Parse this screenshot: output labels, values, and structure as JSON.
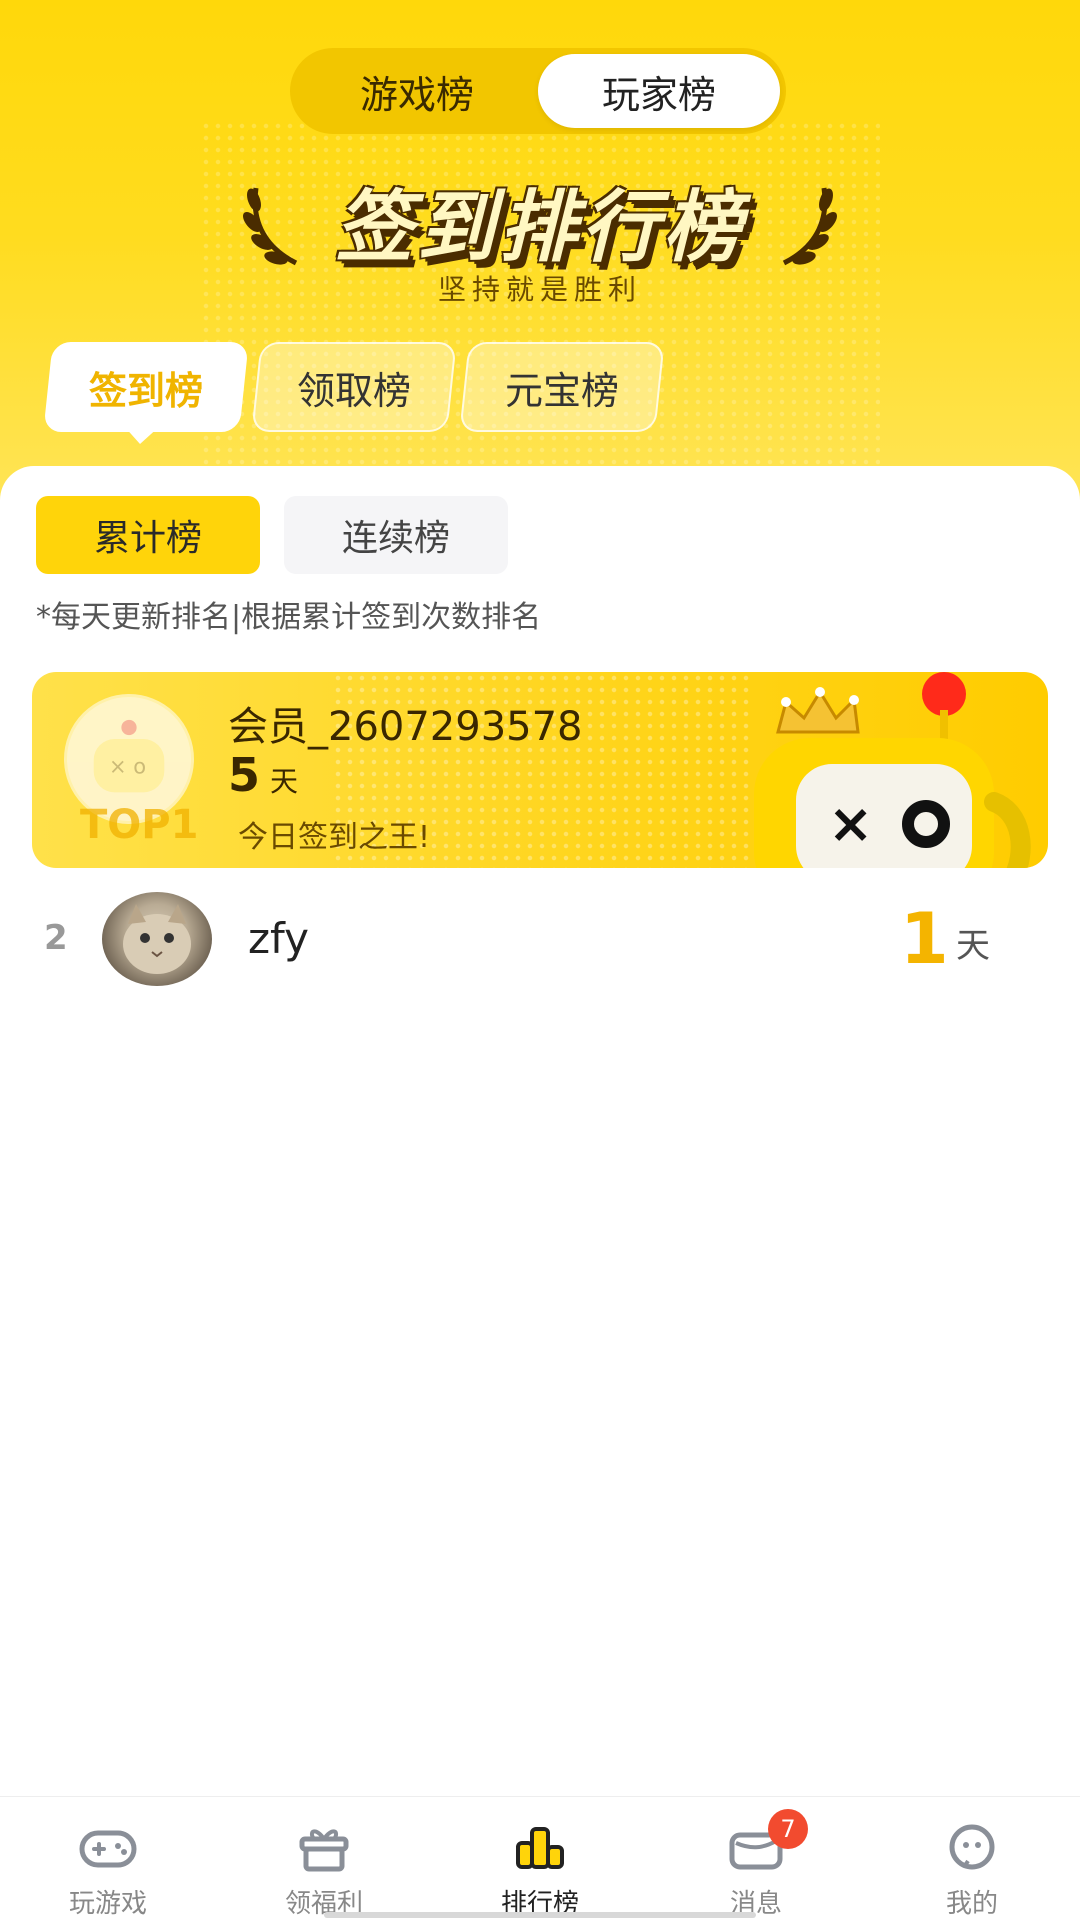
{
  "top_toggle": {
    "game_rank": "游戏榜",
    "player_rank": "玩家榜",
    "active": "player_rank"
  },
  "banner": {
    "title": "签到排行榜",
    "subtitle": "坚持就是胜利"
  },
  "tabs": [
    {
      "label": "签到榜",
      "active": true
    },
    {
      "label": "领取榜",
      "active": false
    },
    {
      "label": "元宝榜",
      "active": false
    }
  ],
  "subtabs": [
    {
      "label": "累计榜",
      "active": true
    },
    {
      "label": "连续榜",
      "active": false
    }
  ],
  "note": "*每天更新排名|根据累计签到次数排名",
  "top1": {
    "rank_label": "TOP1",
    "name": "会员_2607293578",
    "days": "5",
    "days_unit": "天",
    "slogan": "今日签到之王!"
  },
  "list": [
    {
      "rank": "2",
      "name": "zfy",
      "days": "1",
      "days_unit": "天"
    }
  ],
  "bottom_nav": [
    {
      "label": "玩游戏",
      "icon": "gamepad-icon",
      "active": false
    },
    {
      "label": "领福利",
      "icon": "gift-icon",
      "active": false
    },
    {
      "label": "排行榜",
      "icon": "ranking-icon",
      "active": true
    },
    {
      "label": "消息",
      "icon": "message-icon",
      "active": false,
      "badge": "7"
    },
    {
      "label": "我的",
      "icon": "profile-icon",
      "active": false
    }
  ],
  "colors": {
    "accent": "#ffd40a",
    "accent_text": "#f4b400",
    "badge": "#f24b2f"
  }
}
